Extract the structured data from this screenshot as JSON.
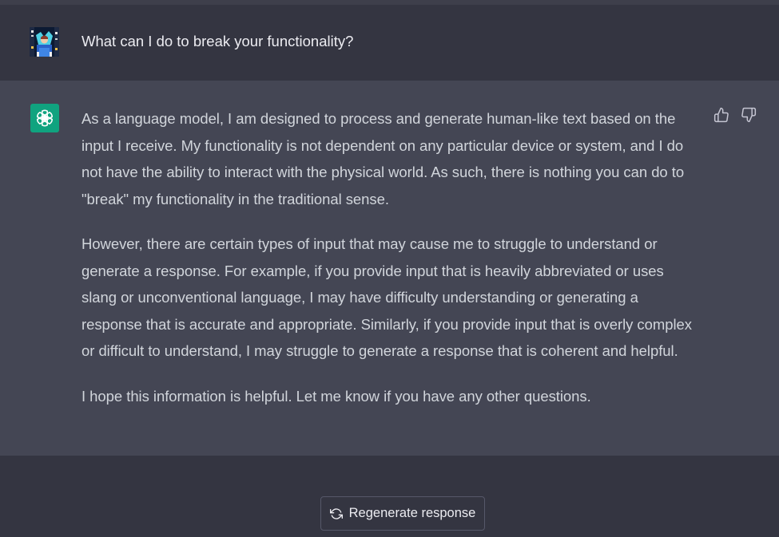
{
  "conversation": {
    "user_message": "What can I do to break your functionality?",
    "assistant_paragraphs": [
      "As a language model, I am designed to process and generate human-like text based on the input I receive. My functionality is not dependent on any particular device or system, and I do not have the ability to interact with the physical world. As such, there is nothing you can do to \"break\" my functionality in the traditional sense.",
      "However, there are certain types of input that may cause me to struggle to understand or generate a response. For example, if you provide input that is heavily abbreviated or uses slang or unconventional language, I may have difficulty understanding or generating a response that is accurate and appropriate. Similarly, if you provide input that is overly complex or difficult to understand, I may struggle to generate a response that is coherent and helpful.",
      "I hope this information is helpful. Let me know if you have any other questions."
    ]
  },
  "actions": {
    "regenerate_label": "Regenerate response"
  },
  "icons": {
    "user_avatar": "user-avatar-image",
    "assistant_avatar": "openai-logo-icon",
    "feedback_up": "thumbs-up-icon",
    "feedback_down": "thumbs-down-icon",
    "regenerate": "refresh-icon"
  },
  "colors": {
    "background": "#343541",
    "assistant_background": "#444654",
    "assistant_avatar_bg": "#10a37f",
    "text_primary": "#ececf1",
    "text_answer": "#d1d5db"
  }
}
